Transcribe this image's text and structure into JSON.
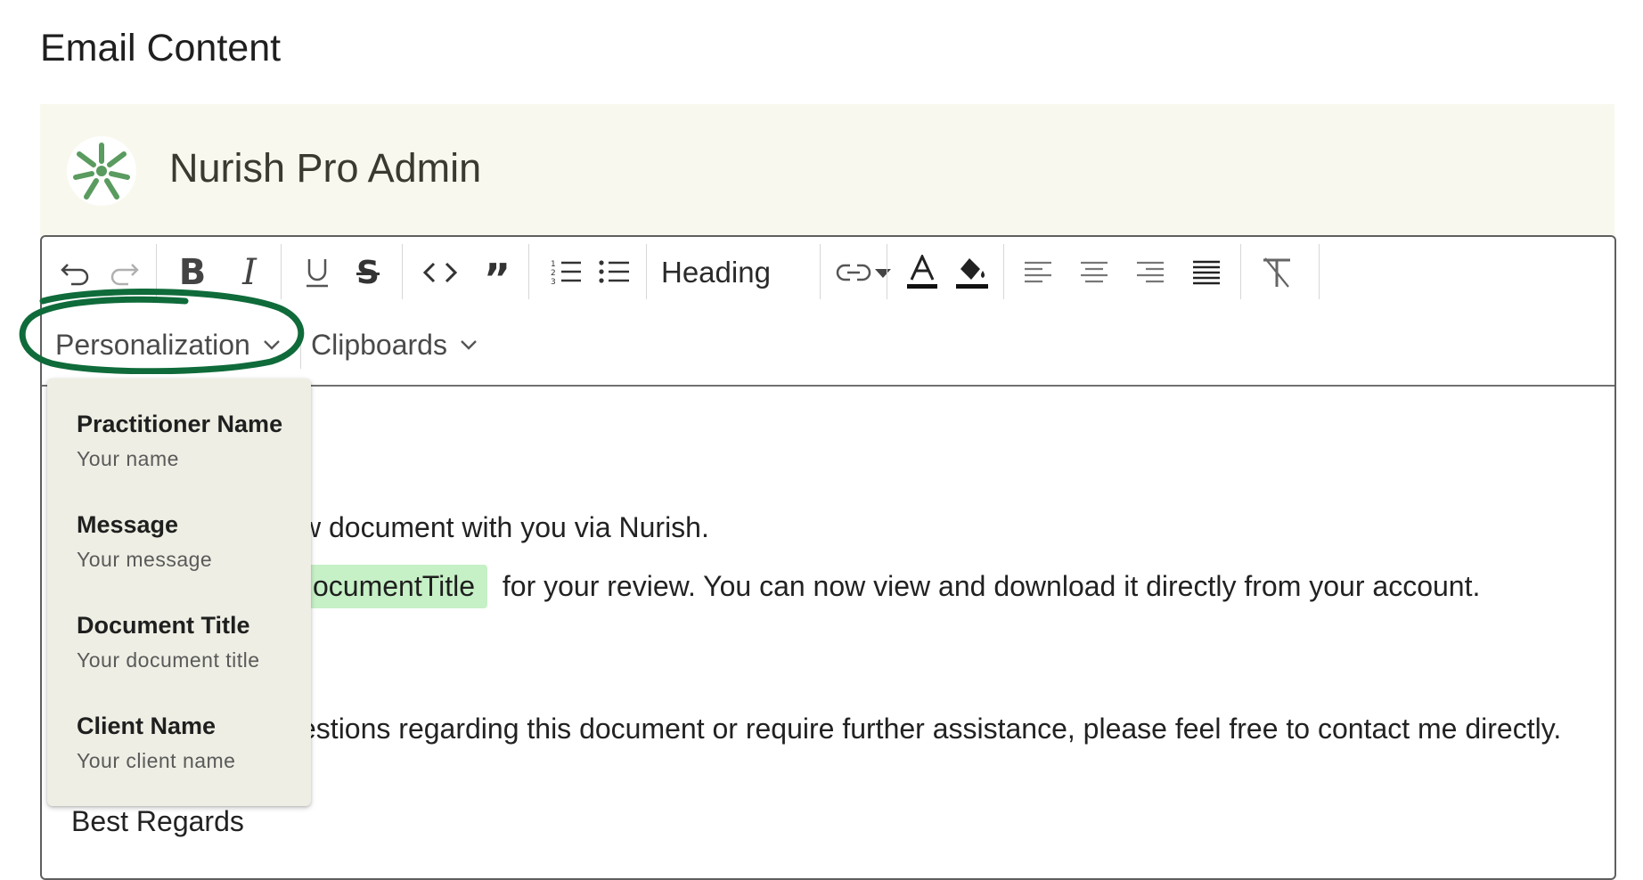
{
  "section": {
    "title": "Email Content"
  },
  "brand": {
    "name": "Nurish Pro Admin",
    "logo_icon": "nurish-logo-icon",
    "accent": "#5a9b5f"
  },
  "toolbar": {
    "row1_icons": [
      "undo-icon",
      "redo-icon",
      "bold-icon",
      "italic-icon",
      "underline-icon",
      "strikethrough-icon",
      "code-icon",
      "blockquote-icon",
      "ordered-list-icon",
      "bullet-list-icon",
      "link-icon",
      "text-color-icon",
      "highlight-color-icon",
      "align-left-icon",
      "align-center-icon",
      "align-right-icon",
      "align-justify-icon",
      "clear-formatting-icon"
    ],
    "heading_select": {
      "value": "Heading"
    },
    "personalization_label": "Personalization",
    "clipboards_label": "Clipboards"
  },
  "annotation": {
    "ring_color": "#0f6b3a"
  },
  "content": {
    "line1_text": "w document with you via Nurish.",
    "line2_chip": "ocumentTitle",
    "line2_text": "for your review. You can now view and download it directly from your account.",
    "line3_text": "estions regarding this document or require further assistance, please feel free to contact me directly.",
    "line4_text": "Best Regards"
  },
  "personalization_menu": {
    "items": [
      {
        "title": "Practitioner Name",
        "subtitle": "Your name"
      },
      {
        "title": "Message",
        "subtitle": "Your message"
      },
      {
        "title": "Document Title",
        "subtitle": "Your document title"
      },
      {
        "title": "Client Name",
        "subtitle": "Your client name"
      }
    ]
  }
}
